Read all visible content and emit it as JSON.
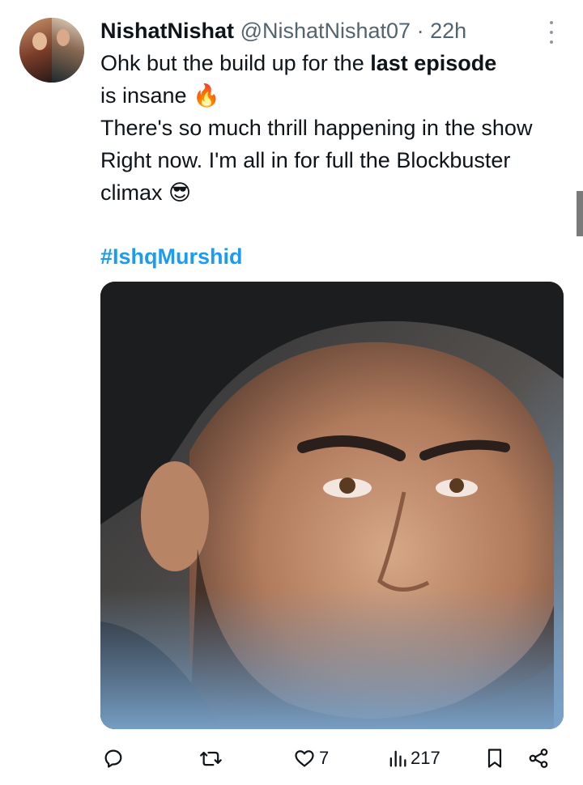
{
  "author": {
    "display_name": "NishatNishat",
    "handle": "@NishatNishat07",
    "separator": " · ",
    "time": "22h"
  },
  "tweet": {
    "line1_prefix": "Ohk but the build up for the ",
    "line1_bold": "last episode",
    "line2": "is insane",
    "line2_emoji": "🔥",
    "line3": "There's so much thrill happening in the show Right now. I'm all in for full the Blockbuster climax",
    "line3_emoji": "😎",
    "hashtag": "#IshqMurshid"
  },
  "actions": {
    "reply_count": "",
    "retweet_count": "",
    "like_count": "7",
    "views_count": "217"
  },
  "icons": {
    "more": "more-vertical-icon",
    "reply": "reply-icon",
    "retweet": "retweet-icon",
    "like": "heart-icon",
    "views": "views-chart-icon",
    "bookmark": "bookmark-icon",
    "share": "share-icon"
  },
  "colors": {
    "text": "#0f1419",
    "muted": "#536471",
    "link": "#1d9bf0"
  }
}
